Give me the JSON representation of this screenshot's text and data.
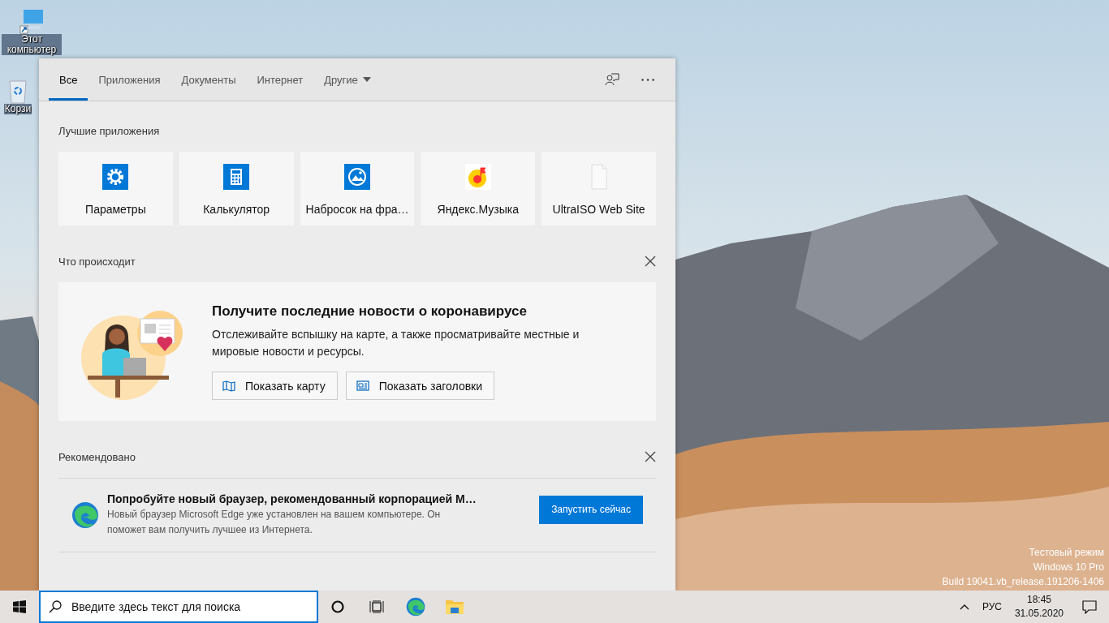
{
  "desktop_icons": [
    {
      "label": "Этот компьютер"
    },
    {
      "label": "Корзи"
    }
  ],
  "search_panel": {
    "tabs": [
      {
        "label": "Все",
        "selected": true,
        "kind": "tab"
      },
      {
        "label": "Приложения",
        "selected": false,
        "kind": "tab"
      },
      {
        "label": "Документы",
        "selected": false,
        "kind": "tab"
      },
      {
        "label": "Интернет",
        "selected": false,
        "kind": "tab"
      },
      {
        "label": "Другие",
        "selected": false,
        "kind": "dropdown"
      }
    ],
    "top_apps": {
      "title": "Лучшие приложения",
      "items": [
        {
          "label": "Параметры"
        },
        {
          "label": "Калькулятор"
        },
        {
          "label": "Набросок на фра…"
        },
        {
          "label": "Яндекс.Музыка"
        },
        {
          "label": "UltraISO Web Site"
        }
      ]
    },
    "whats_happening": {
      "title": "Что происходит",
      "card": {
        "title": "Получите последние новости о коронавирусе",
        "text": "Отслеживайте вспышку на карте, а также просматривайте местные и мировые новости и ресурсы.",
        "buttons": [
          {
            "label": "Показать карту"
          },
          {
            "label": "Показать заголовки"
          }
        ]
      }
    },
    "recommended": {
      "title": "Рекомендовано",
      "item": {
        "title": "Попробуйте новый браузер, рекомендованный корпорацией М…",
        "text": "Новый браузер Microsoft Edge уже установлен на вашем компьютере. Он поможет вам получить лучшее из Интернета.",
        "button": "Запустить сейчас"
      }
    }
  },
  "watermark": [
    "Тестовый режим",
    "Windows 10 Pro",
    "Build 19041.vb_release.191206-1406"
  ],
  "taskbar": {
    "search": {
      "placeholder": "Введите здесь текст для поиска"
    },
    "language": "РУС",
    "time": "18:45",
    "date": "31.05.2020"
  }
}
